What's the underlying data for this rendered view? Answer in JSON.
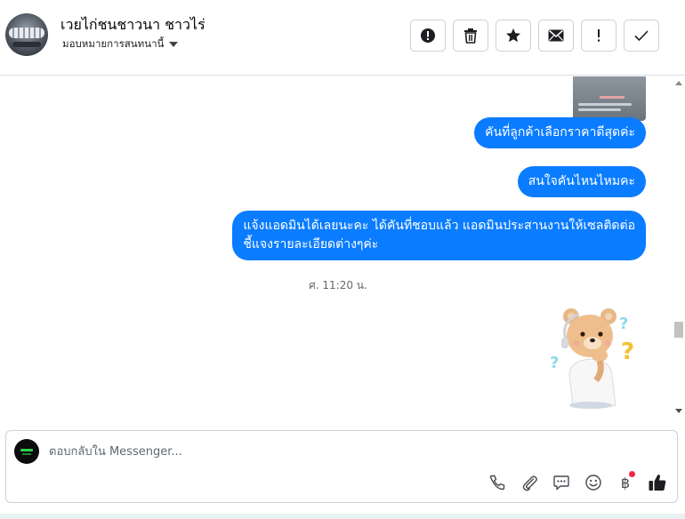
{
  "header": {
    "contact_name": "เวยไก่ชนชาวนา ชาวไร่",
    "assign_label": "มอบหมายการสนทนานี้",
    "actions": [
      {
        "name": "report",
        "icon": "alert-circle-icon"
      },
      {
        "name": "delete",
        "icon": "trash-icon"
      },
      {
        "name": "star",
        "icon": "star-icon"
      },
      {
        "name": "mark-unread",
        "icon": "envelope-icon"
      },
      {
        "name": "mark-important",
        "icon": "exclamation-icon"
      },
      {
        "name": "mark-done",
        "icon": "check-icon"
      }
    ]
  },
  "conversation": {
    "messages": [
      {
        "text": "คันที่ลูกค้าเลือกราคาดีสุดค่ะ"
      },
      {
        "text": "สนใจคันไหนไหมคะ"
      },
      {
        "line1": "แจ้งแอดมินได้เลยนะคะ ได้คันที่ชอบแล้ว แอดมินประสานงานให้เซลติดต่อ",
        "line2": "ชี้แจงรายละเอียดต่างๆค่ะ"
      }
    ],
    "timestamp": "ศ. 11:20 น.",
    "sticker": "thinking-bear-sticker"
  },
  "composer": {
    "placeholder": "ตอบกลับใน Messenger...",
    "tools": [
      "phone-icon",
      "paperclip-icon",
      "saved-reply-icon",
      "emoji-icon",
      "baht-icon",
      "thumbs-up-icon"
    ],
    "baht_symbol": "฿"
  },
  "colors": {
    "bubble": "#0a7cff",
    "notification_dot": "#f02849"
  }
}
